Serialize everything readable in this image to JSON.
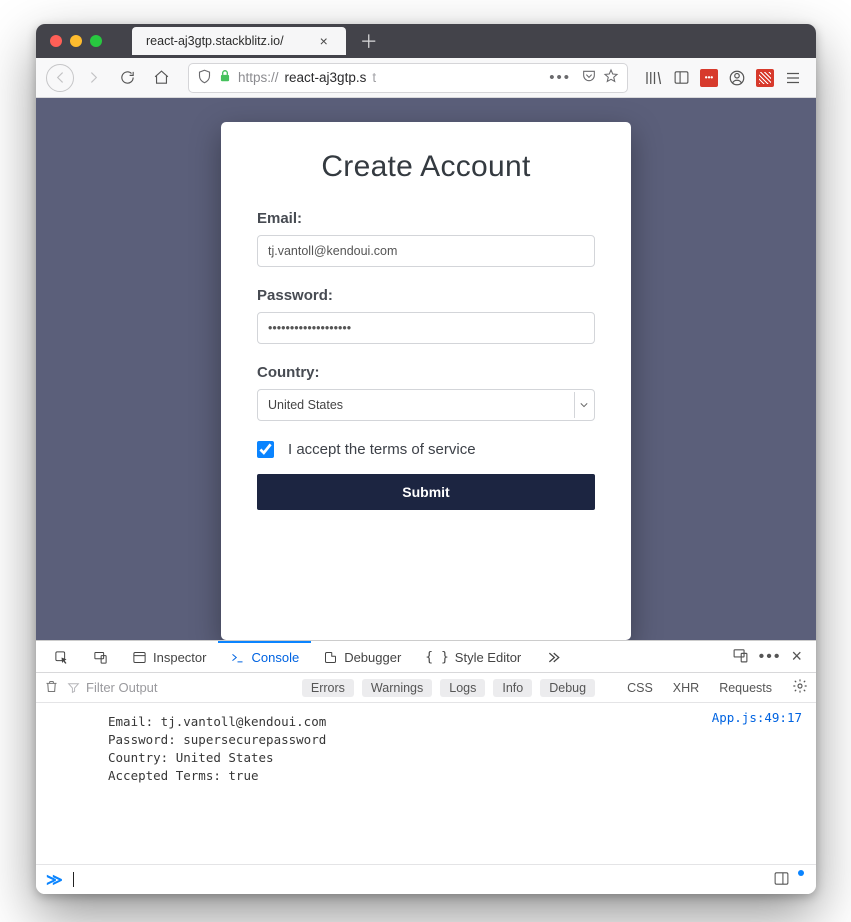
{
  "browser": {
    "tab_title": "react-aj3gtp.stackblitz.io/",
    "url_protocol": "https://",
    "url_host": "react-aj3gtp.s",
    "url_rest": "t"
  },
  "form": {
    "title": "Create Account",
    "email_label": "Email:",
    "email_value": "tj.vantoll@kendoui.com",
    "password_label": "Password:",
    "password_value": "supersecurepassword",
    "country_label": "Country:",
    "country_value": "United States",
    "terms_label": "I accept the terms of service",
    "terms_checked": true,
    "submit_label": "Submit"
  },
  "devtools": {
    "tabs": {
      "inspector": "Inspector",
      "console": "Console",
      "debugger": "Debugger",
      "style_editor": "Style Editor"
    },
    "filter_placeholder": "Filter Output",
    "chips": {
      "errors": "Errors",
      "warnings": "Warnings",
      "logs": "Logs",
      "info": "Info",
      "debug": "Debug"
    },
    "links": {
      "css": "CSS",
      "xhr": "XHR",
      "requests": "Requests"
    },
    "source_link": "App.js:49:17",
    "log_lines": [
      "Email: tj.vantoll@kendoui.com",
      "Password: supersecurepassword",
      "Country: United States",
      "Accepted Terms: true"
    ]
  }
}
